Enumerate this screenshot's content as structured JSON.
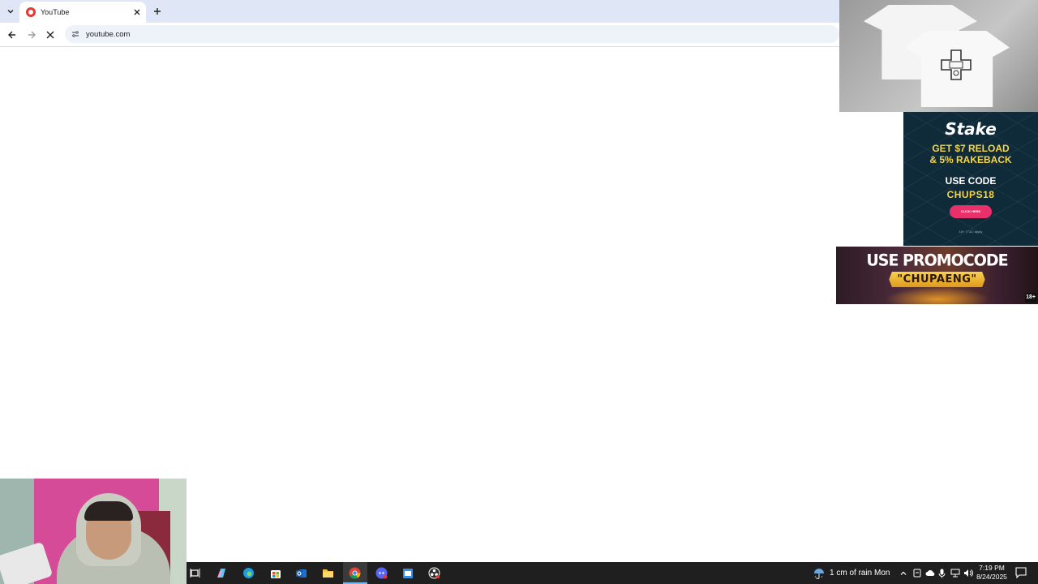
{
  "browser": {
    "tab": {
      "title": "YouTube"
    },
    "address_bar": {
      "url": "youtube.com"
    }
  },
  "ads": {
    "stake": {
      "brand": "Stake",
      "offer_line1": "GET $7 RELOAD",
      "offer_line2": "& 5% RAKEBACK",
      "use_code": "USE CODE",
      "code": "CHUPS18",
      "button": "CLICK HERE",
      "terms": "18+ | T&C apply"
    },
    "promo": {
      "title": "USE PROMOCODE",
      "code": "\"CHUPAENG\"",
      "age": "18+"
    }
  },
  "taskbar": {
    "weather": "1 cm of rain Mon",
    "time": "7:19 PM",
    "date": "8/24/2025"
  },
  "colors": {
    "tabstrip": "#dfe7f6",
    "taskbar": "#1f1f1f",
    "stake_bg": "#0f2a38",
    "stake_accent": "#f5d54a",
    "stake_button": "#e8316a",
    "webcam_wall": "#d64b98"
  }
}
